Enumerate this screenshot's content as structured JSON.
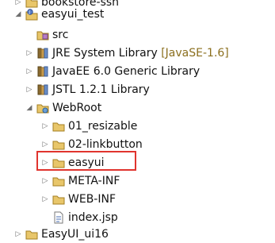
{
  "tree": {
    "top_partial": "bookstore-ssh",
    "project": "easyui_test",
    "src": "src",
    "jre": "JRE System Library",
    "jre_version": "[JavaSE-1.6]",
    "javaee": "JavaEE 6.0 Generic Library",
    "jstl": "JSTL 1.2.1 Library",
    "webroot": "WebRoot",
    "folder1": "01_resizable",
    "folder2": "02-linkbutton",
    "folder3": "easyui",
    "folder4": "META-INF",
    "folder5": "WEB-INF",
    "file1": "index.jsp",
    "bottom_partial": "EasyUI_ui16"
  },
  "colors": {
    "highlight_border": "#e0342e",
    "decoration": "#8b6f1e"
  },
  "highlighted_item": "easyui"
}
